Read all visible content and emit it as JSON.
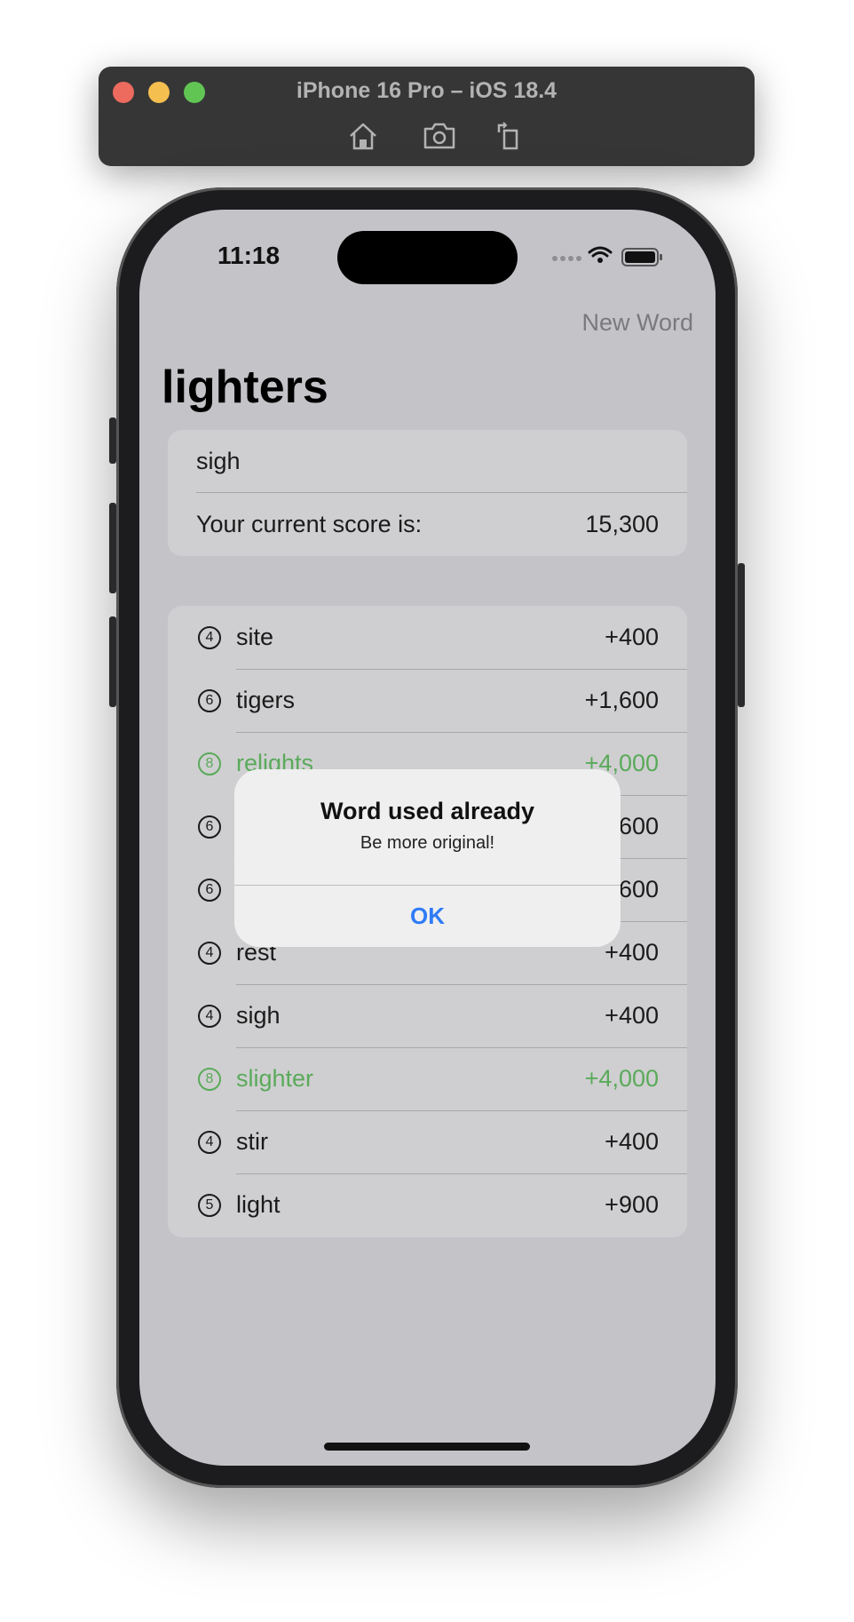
{
  "simulator": {
    "title": "iPhone 16 Pro – iOS 18.4",
    "icons": [
      "home-icon",
      "screenshot-icon",
      "rotate-icon"
    ]
  },
  "status_bar": {
    "time": "11:18",
    "icons": [
      "cellular-icon",
      "wifi-icon",
      "battery-icon"
    ]
  },
  "nav": {
    "new_word_label": "New Word",
    "title": "lighters"
  },
  "entry": {
    "input_value": "sigh",
    "score_label": "Your current score is:",
    "score_value": "15,300"
  },
  "words": [
    {
      "length": "4",
      "word": "site",
      "points": "+400",
      "highlight": false
    },
    {
      "length": "6",
      "word": "tigers",
      "points": "+1,600",
      "highlight": false
    },
    {
      "length": "8",
      "word": "relights",
      "points": "+4,000",
      "highlight": true
    },
    {
      "length": "6",
      "word": "",
      "points": "600",
      "highlight": false
    },
    {
      "length": "6",
      "word": "",
      "points": "600",
      "highlight": false
    },
    {
      "length": "4",
      "word": "rest",
      "points": "+400",
      "highlight": false
    },
    {
      "length": "4",
      "word": "sigh",
      "points": "+400",
      "highlight": false
    },
    {
      "length": "8",
      "word": "slighter",
      "points": "+4,000",
      "highlight": true
    },
    {
      "length": "4",
      "word": "stir",
      "points": "+400",
      "highlight": false
    },
    {
      "length": "5",
      "word": "light",
      "points": "+900",
      "highlight": false
    }
  ],
  "alert": {
    "title": "Word used already",
    "message": "Be more original!",
    "button": "OK"
  },
  "colors": {
    "accent": "#2f7cf6",
    "highlight_green": "#5aaa5a"
  }
}
